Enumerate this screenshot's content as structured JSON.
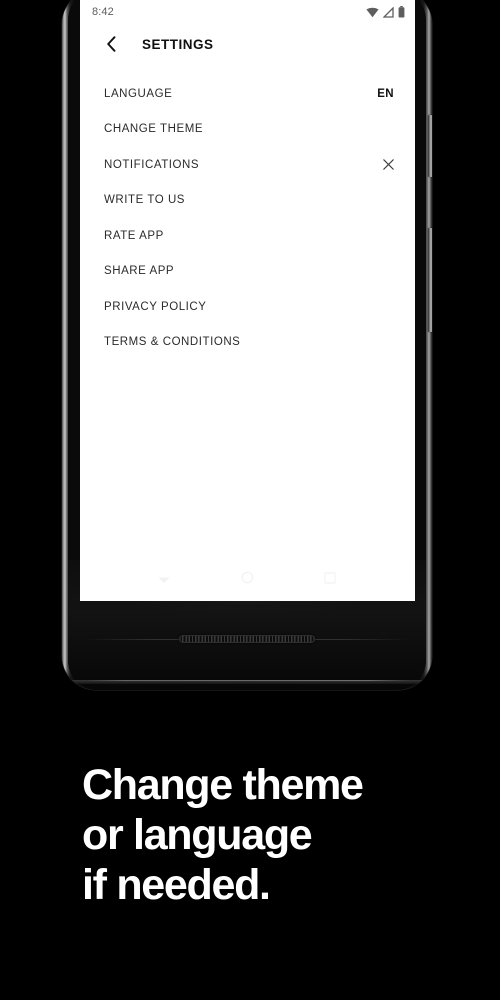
{
  "device": {
    "name": "android-phone-mockup",
    "body_color": "#0a0a0a",
    "buttons": [
      {
        "name": "power-button",
        "label": "Power"
      },
      {
        "name": "volume-button",
        "label": "Volume"
      }
    ],
    "speaker": "bottom-speaker-grille"
  },
  "status_bar": {
    "time": "8:42",
    "icons": [
      {
        "name": "wifi-icon",
        "label": "Wi-Fi"
      },
      {
        "name": "cellular-signal-icon",
        "label": "Signal"
      },
      {
        "name": "battery-icon",
        "label": "Battery"
      }
    ],
    "icon_color": "#5e5e5e",
    "background": "#ffffff"
  },
  "app_bar": {
    "back_icon": "chevron-left-icon",
    "title": "SETTINGS",
    "title_color": "#111111"
  },
  "settings_menu": {
    "items": [
      {
        "label": "LANGUAGE",
        "value": "EN",
        "trailing_icon": ""
      },
      {
        "label": "CHANGE THEME",
        "value": "",
        "trailing_icon": ""
      },
      {
        "label": "NOTIFICATIONS",
        "value": "",
        "trailing_icon": "close-x-icon"
      },
      {
        "label": "WRITE TO US",
        "value": "",
        "trailing_icon": ""
      },
      {
        "label": "RATE APP",
        "value": "",
        "trailing_icon": ""
      },
      {
        "label": "SHARE APP",
        "value": "",
        "trailing_icon": ""
      },
      {
        "label": "PRIVACY POLICY",
        "value": "",
        "trailing_icon": ""
      },
      {
        "label": "TERMS & CONDITIONS",
        "value": "",
        "trailing_icon": ""
      }
    ],
    "text_color": "#2b2b2b",
    "background": "#ffffff"
  },
  "android_nav": {
    "buttons": [
      {
        "name": "nav-back-icon",
        "label": "Back"
      },
      {
        "name": "nav-home-icon",
        "label": "Home"
      },
      {
        "name": "nav-recents-icon",
        "label": "Recents"
      }
    ],
    "icon_color": "#f1f1f1"
  },
  "headline": {
    "line1": "Change theme",
    "line2": "or language",
    "line3": "if needed.",
    "color": "#ffffff"
  },
  "page": {
    "background": "#000000"
  }
}
